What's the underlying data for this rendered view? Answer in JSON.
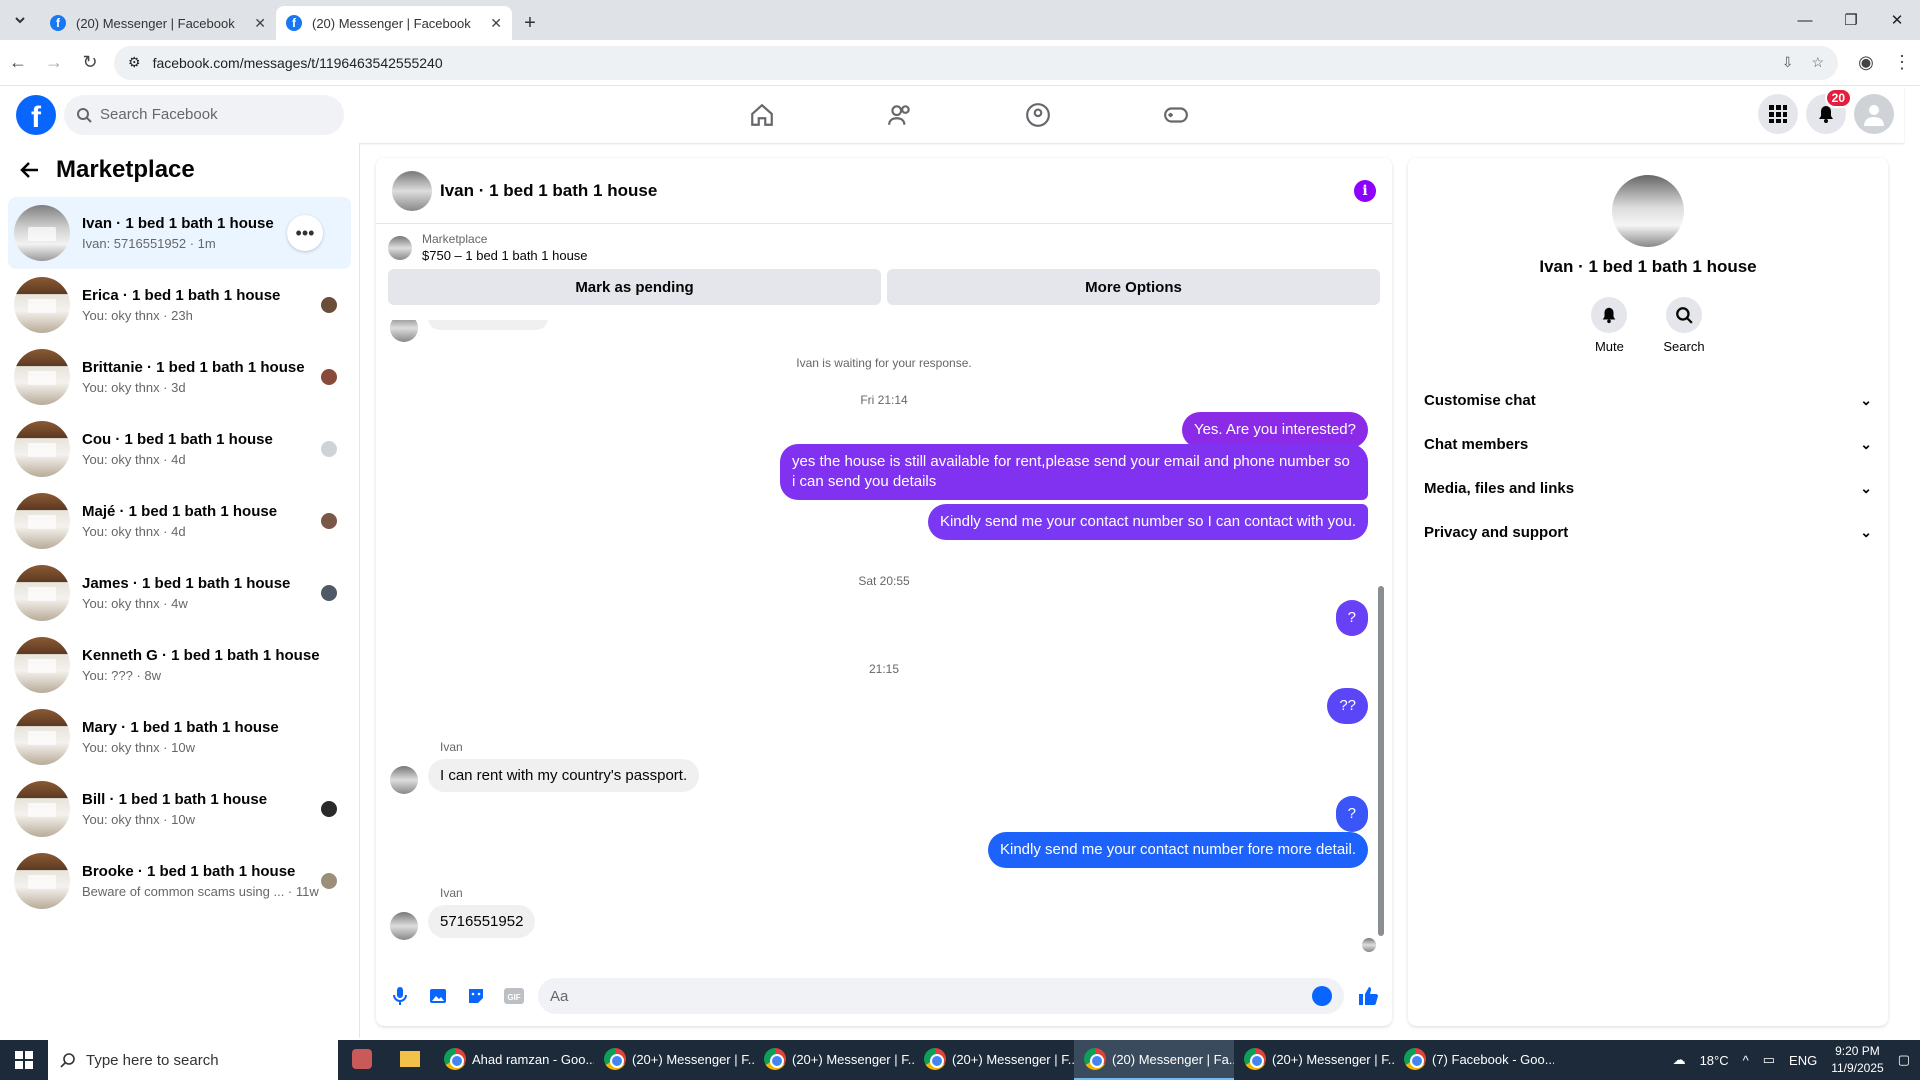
{
  "browser": {
    "tabs": [
      {
        "title": "(20) Messenger | Facebook",
        "active": false
      },
      {
        "title": "(20) Messenger | Facebook",
        "active": true
      }
    ],
    "url": "facebook.com/messages/t/1196463542555240"
  },
  "header": {
    "search_placeholder": "Search Facebook",
    "notif_count": "20"
  },
  "sidebar": {
    "title": "Marketplace",
    "conversations": [
      {
        "title": "Ivan · 1 bed 1 bath 1 house",
        "sub": "Ivan: 5716551952 · 1m",
        "selected": true
      },
      {
        "title": "Erica · 1 bed 1 bath 1 house",
        "sub": "You: oky thnx · 23h"
      },
      {
        "title": "Brittanie · 1 bed 1 bath 1 house",
        "sub": "You: oky thnx · 3d"
      },
      {
        "title": "Cou · 1 bed 1 bath 1 house",
        "sub": "You: oky thnx · 4d"
      },
      {
        "title": "Majé · 1 bed 1 bath 1 house",
        "sub": "You: oky thnx · 4d"
      },
      {
        "title": "James · 1 bed 1 bath 1 house",
        "sub": "You: oky thnx · 4w"
      },
      {
        "title": "Kenneth G · 1 bed 1 bath 1 house",
        "sub": "You: ??? · 8w"
      },
      {
        "title": "Mary · 1 bed 1 bath 1 house",
        "sub": "You: oky thnx · 10w"
      },
      {
        "title": "Bill · 1 bed 1 bath 1 house",
        "sub": "You: oky thnx · 10w"
      },
      {
        "title": "Brooke · 1 bed 1 bath 1 house",
        "sub": "Beware of common scams using ... · 11w"
      }
    ]
  },
  "chat": {
    "title": "Ivan · 1 bed 1 bath 1 house",
    "marketplace_label": "Marketplace",
    "listing": "$750 – 1 bed 1 bath 1 house",
    "btn_pending": "Mark as pending",
    "btn_more": "More Options",
    "waiting": "Ivan is waiting for your response.",
    "ts1": "Fri 21:14",
    "m1": "Yes. Are you interested?",
    "m2": "yes the house is still available for rent,please send your email and phone number so i can send you details",
    "m3": "Kindly send me your contact number so I can contact with you.",
    "ts2": "Sat 20:55",
    "m4": "?",
    "ts3": "21:15",
    "m5": "??",
    "sender": "Ivan",
    "m6": "I can rent with my country's passport.",
    "m7": "?",
    "m8": "Kindly send me your contact number fore more detail.",
    "m9": "5716551952",
    "composer_placeholder": "Aa"
  },
  "details": {
    "name": "Ivan · 1 bed 1 bath 1 house",
    "mute": "Mute",
    "search": "Search",
    "sections": [
      "Customise chat",
      "Chat members",
      "Media, files and links",
      "Privacy and support"
    ]
  },
  "taskbar": {
    "search": "Type here to search",
    "apps": [
      "Ahad ramzan - Goo...",
      "(20+) Messenger | F...",
      "(20+) Messenger | F...",
      "(20+) Messenger | F...",
      "(20) Messenger | Fa...",
      "(20+) Messenger | F...",
      "(7) Facebook - Goo..."
    ],
    "temp": "18°C",
    "lang": "ENG",
    "time": "9:20 PM",
    "date": "11/9/2025"
  },
  "colors": {
    "brand": "#0866ff",
    "bubble_top": "#8a2be2",
    "bubble_bottom": "#0866ff",
    "selected": "#ebf5ff"
  }
}
